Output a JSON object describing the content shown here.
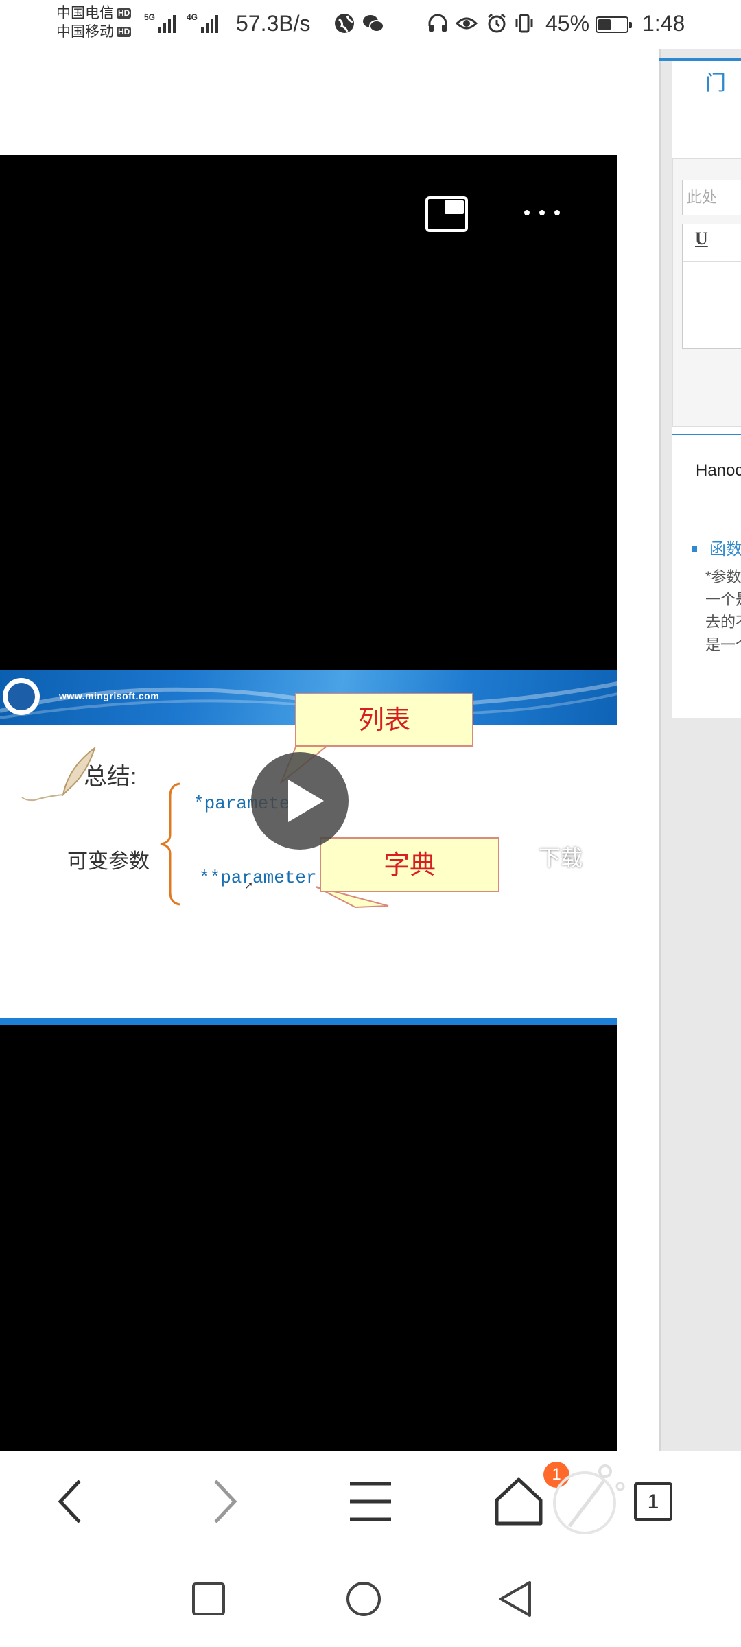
{
  "status_bar": {
    "carrier1": "中国电信",
    "carrier2": "中国移动",
    "hd": "HD",
    "net1": "5G",
    "net2": "4G",
    "speed": "57.3B/s",
    "battery_percent": "45%",
    "battery_level": 0.45,
    "time": "1:48",
    "icons": [
      "globe-icon",
      "wechat-icon",
      "headphones-icon",
      "eye-icon",
      "alarm-icon",
      "vibrate-icon"
    ]
  },
  "side_page": {
    "input_placeholder": "此处",
    "editor_underline_label": "U",
    "title_fragment": "Hanoc",
    "section_link": "函数",
    "paragraph_lines": [
      "*参数",
      "一个是",
      "去的不",
      "是一个"
    ]
  },
  "video": {
    "slide": {
      "website": "www.mingrisoft.com",
      "summary_label": "总结:",
      "variable_params_label": "可变参数",
      "param_single": "*parameter",
      "param_double": "**parameter",
      "callout_list": "列表",
      "callout_dict": "字典"
    },
    "download_label": "下载"
  },
  "toolbar": {
    "tab_count": "1",
    "notification_count": "1"
  },
  "colors": {
    "accent_blue": "#2e8ad0",
    "code_blue": "#1a6fb0",
    "callout_red": "#d81e1e",
    "badge_orange": "#ff6a2a"
  }
}
